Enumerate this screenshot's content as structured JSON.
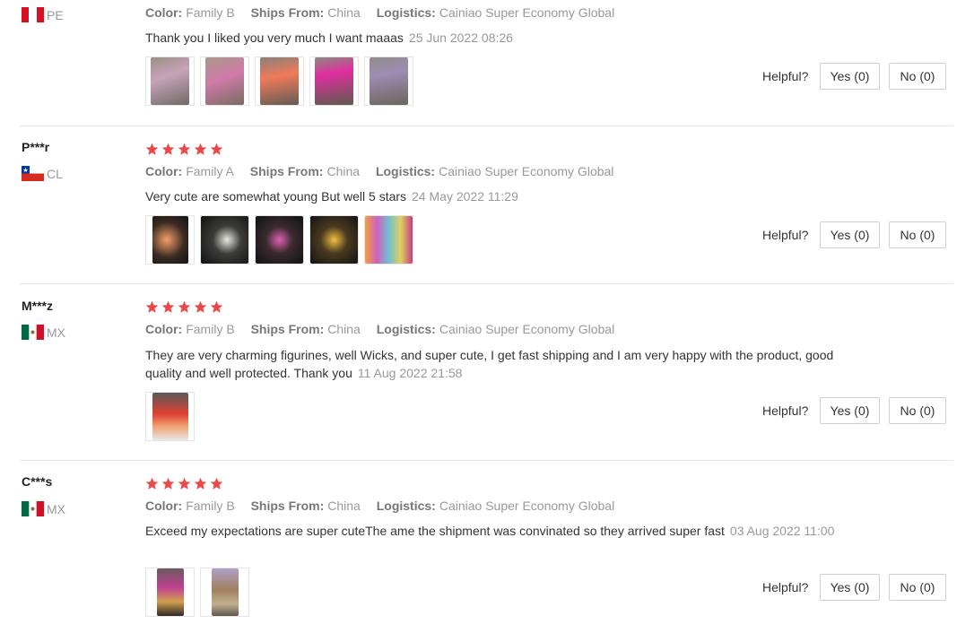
{
  "labels": {
    "color": "Color:",
    "ships_from": "Ships From:",
    "logistics": "Logistics:",
    "helpful": "Helpful?"
  },
  "colors": {
    "star": "#e84a4a",
    "meta": "#999999",
    "divider": "#e6e6e6"
  },
  "reviews": [
    {
      "user": "",
      "country": "PE",
      "flag": "peru-flag-icon",
      "stars": 0,
      "color": "Family B",
      "ships_from": "China",
      "logistics": "Cainiao Super Economy Global",
      "text": "Thank you I liked you very much I want maaas",
      "date": "25 Jun 2022 08:26",
      "photos": 5,
      "yes": "Yes (0)",
      "no": "No (0)"
    },
    {
      "user": "P***r",
      "country": "CL",
      "flag": "chile-flag-icon",
      "stars": 5,
      "color": "Family A",
      "ships_from": "China",
      "logistics": "Cainiao Super Economy Global",
      "text": "Very cute are somewhat young But well 5 stars",
      "date": "24 May 2022 11:29",
      "photos": 5,
      "yes": "Yes (0)",
      "no": "No (0)"
    },
    {
      "user": "M***z",
      "country": "MX",
      "flag": "mexico-flag-icon",
      "stars": 5,
      "color": "Family B",
      "ships_from": "China",
      "logistics": "Cainiao Super Economy Global",
      "text": "They are very charming figurines, well Wicks, and super cute, I get fast shipping and I am very happy with the product, good quality and well protected. Thank you",
      "date": "11 Aug 2022 21:58",
      "photos": 1,
      "yes": "Yes (0)",
      "no": "No (0)"
    },
    {
      "user": "C***s",
      "country": "MX",
      "flag": "mexico-flag-icon",
      "stars": 5,
      "color": "Family B",
      "ships_from": "China",
      "logistics": "Cainiao Super Economy Global",
      "text": "Exceed my expectations are super cuteThe ame the shipment was convinated so they arrived super fast",
      "date": "03 Aug 2022 11:00",
      "photos": 2,
      "yes": "Yes (0)",
      "no": "No (0)"
    }
  ]
}
